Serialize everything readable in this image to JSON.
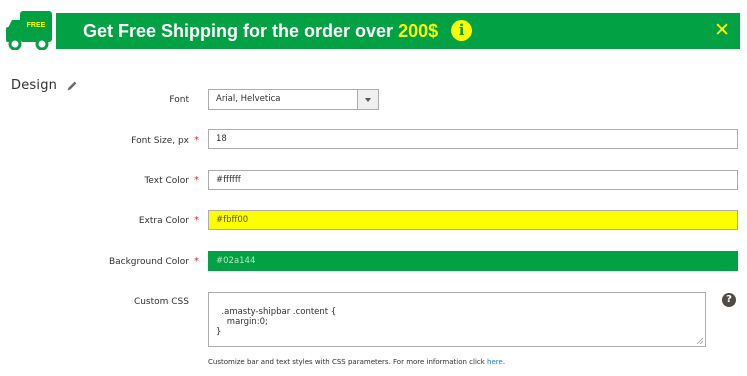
{
  "preview": {
    "truck_badge": "FREE",
    "message": "Get Free Shipping for the order over",
    "amount": "200$",
    "info_glyph": "i",
    "close_glyph": "✕",
    "colors": {
      "background": "#02a144",
      "text": "#ffffff",
      "extra": "#fbff00"
    }
  },
  "section": {
    "title": "Design"
  },
  "form": {
    "font": {
      "label": "Font",
      "value": "Arial, Helvetica"
    },
    "font_size": {
      "label": "Font Size, px",
      "value": "18",
      "required": "*"
    },
    "text_color": {
      "label": "Text Color",
      "value": "#ffffff",
      "required": "*"
    },
    "extra_color": {
      "label": "Extra Color",
      "value": "#fbff00",
      "required": "*"
    },
    "background_color": {
      "label": "Background Color",
      "value": "#02a144",
      "required": "*"
    },
    "custom_css": {
      "label": "Custom CSS",
      "value": ".amasty-shipbar .content {\n    margin:0;\n}",
      "help_glyph": "?",
      "note": "Customize bar and text styles with CSS parameters. For more information click ",
      "note_link": "here",
      "note_end": "."
    }
  }
}
